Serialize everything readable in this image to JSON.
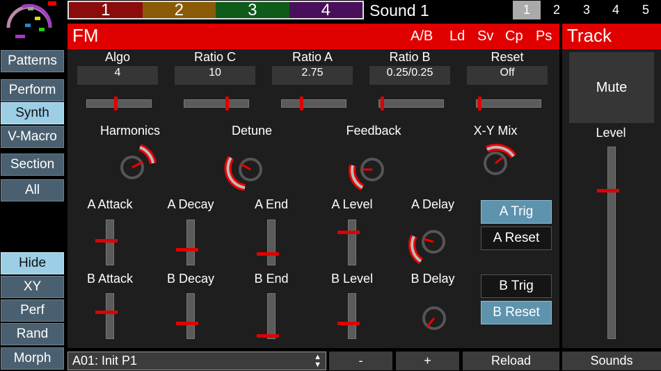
{
  "top": {
    "patterns": [
      "1",
      "2",
      "3",
      "4"
    ],
    "pattern_colors": [
      "#8b0c0c",
      "#8b5a06",
      "#0e5b1a",
      "#4a0f5a"
    ],
    "sound_title": "Sound 1",
    "tracks": [
      "1",
      "2",
      "3",
      "4",
      "5"
    ],
    "active_track": 0
  },
  "sidebar": {
    "top": [
      "Patterns",
      "Perform",
      "Synth",
      "V-Macro",
      "Section",
      "All"
    ],
    "bottom": [
      "Hide",
      "XY",
      "Perf",
      "Rand",
      "Morph"
    ]
  },
  "fm": {
    "title": "FM",
    "menu": [
      "A/B",
      "Ld",
      "Sv",
      "Cp",
      "Ps"
    ],
    "params": [
      {
        "label": "Algo",
        "value": "4",
        "level": 0.45
      },
      {
        "label": "Ratio C",
        "value": "10",
        "level": 0.68
      },
      {
        "label": "Ratio A",
        "value": "2.75",
        "level": 0.3
      },
      {
        "label": "Ratio B",
        "value": "0.25/0.25",
        "level": 0.02
      },
      {
        "label": "Reset",
        "value": "Off",
        "level": 0.02
      }
    ],
    "knobs": [
      "Harmonics",
      "Detune",
      "Feedback",
      "X-Y Mix"
    ],
    "a_row": [
      "A Attack",
      "A Decay",
      "A End",
      "A Level",
      "A Delay"
    ],
    "a_levels": [
      0.55,
      0.35,
      0.25,
      0.75
    ],
    "b_row": [
      "B Attack",
      "B Decay",
      "B End",
      "B Level",
      "B Delay"
    ],
    "b_levels": [
      0.6,
      0.35,
      0.05,
      0.35
    ],
    "buttons": {
      "a_trig": "A Trig",
      "a_reset": "A Reset",
      "b_trig": "B Trig",
      "b_reset": "B Reset"
    }
  },
  "track": {
    "title": "Track",
    "mute": "Mute",
    "level_label": "Level",
    "level": 0.78
  },
  "bottom": {
    "preset": "A01: Init P1",
    "minus": "-",
    "plus": "+",
    "reload": "Reload",
    "sounds": "Sounds"
  }
}
